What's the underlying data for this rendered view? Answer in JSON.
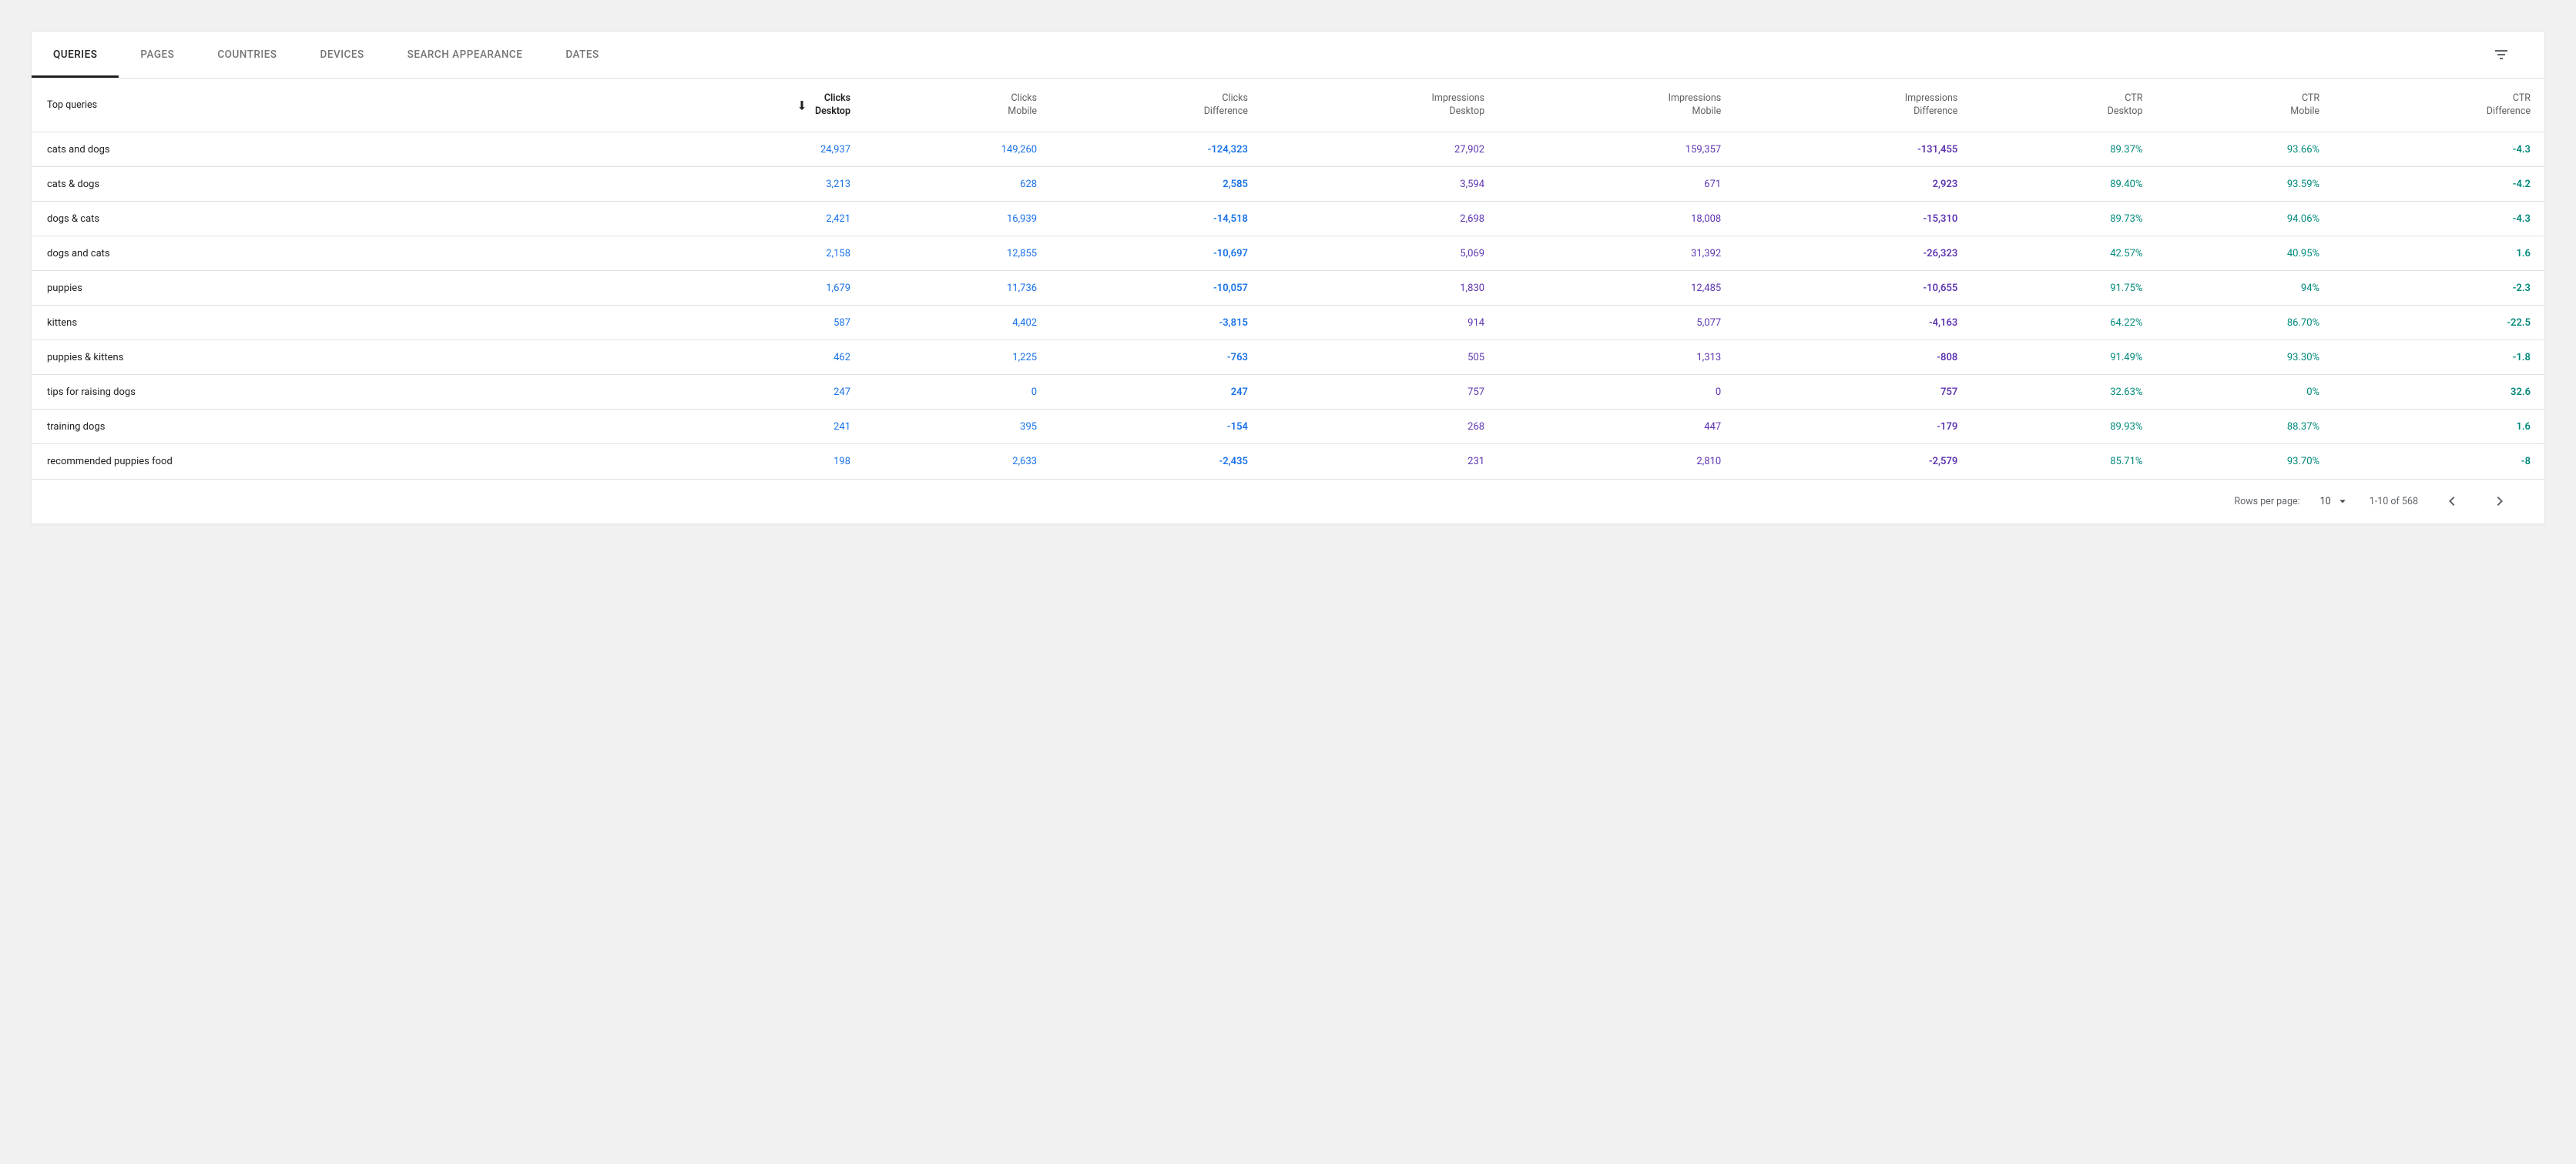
{
  "tabs": [
    {
      "label": "QUERIES",
      "active": true
    },
    {
      "label": "PAGES",
      "active": false
    },
    {
      "label": "COUNTRIES",
      "active": false
    },
    {
      "label": "DEVICES",
      "active": false
    },
    {
      "label": "SEARCH APPEARANCE",
      "active": false
    },
    {
      "label": "DATES",
      "active": false
    }
  ],
  "columns": [
    {
      "line1": "",
      "line2": "Top queries",
      "sortable": false,
      "align": "left"
    },
    {
      "line1": "Clicks",
      "line2": "Desktop",
      "sortable": true,
      "sorted": "desc"
    },
    {
      "line1": "Clicks",
      "line2": "Mobile",
      "sortable": false
    },
    {
      "line1": "Clicks",
      "line2": "Difference",
      "sortable": false
    },
    {
      "line1": "Impressions",
      "line2": "Desktop",
      "sortable": false
    },
    {
      "line1": "Impressions",
      "line2": "Mobile",
      "sortable": false
    },
    {
      "line1": "Impressions",
      "line2": "Difference",
      "sortable": false
    },
    {
      "line1": "CTR",
      "line2": "Desktop",
      "sortable": false
    },
    {
      "line1": "CTR",
      "line2": "Mobile",
      "sortable": false
    },
    {
      "line1": "CTR",
      "line2": "Difference",
      "sortable": false
    }
  ],
  "rows": [
    {
      "query": "cats and dogs",
      "clicks_d": "24,937",
      "clicks_m": "149,260",
      "clicks_diff": "-124,323",
      "impr_d": "27,902",
      "impr_m": "159,357",
      "impr_diff": "-131,455",
      "ctr_d": "89.37%",
      "ctr_m": "93.66%",
      "ctr_diff": "-4.3"
    },
    {
      "query": "cats & dogs",
      "clicks_d": "3,213",
      "clicks_m": "628",
      "clicks_diff": "2,585",
      "impr_d": "3,594",
      "impr_m": "671",
      "impr_diff": "2,923",
      "ctr_d": "89.40%",
      "ctr_m": "93.59%",
      "ctr_diff": "-4.2"
    },
    {
      "query": "dogs & cats",
      "clicks_d": "2,421",
      "clicks_m": "16,939",
      "clicks_diff": "-14,518",
      "impr_d": "2,698",
      "impr_m": "18,008",
      "impr_diff": "-15,310",
      "ctr_d": "89.73%",
      "ctr_m": "94.06%",
      "ctr_diff": "-4.3"
    },
    {
      "query": "dogs and cats",
      "clicks_d": "2,158",
      "clicks_m": "12,855",
      "clicks_diff": "-10,697",
      "impr_d": "5,069",
      "impr_m": "31,392",
      "impr_diff": "-26,323",
      "ctr_d": "42.57%",
      "ctr_m": "40.95%",
      "ctr_diff": "1.6"
    },
    {
      "query": "puppies",
      "clicks_d": "1,679",
      "clicks_m": "11,736",
      "clicks_diff": "-10,057",
      "impr_d": "1,830",
      "impr_m": "12,485",
      "impr_diff": "-10,655",
      "ctr_d": "91.75%",
      "ctr_m": "94%",
      "ctr_diff": "-2.3"
    },
    {
      "query": "kittens",
      "clicks_d": "587",
      "clicks_m": "4,402",
      "clicks_diff": "-3,815",
      "impr_d": "914",
      "impr_m": "5,077",
      "impr_diff": "-4,163",
      "ctr_d": "64.22%",
      "ctr_m": "86.70%",
      "ctr_diff": "-22.5"
    },
    {
      "query": "puppies & kittens",
      "clicks_d": "462",
      "clicks_m": "1,225",
      "clicks_diff": "-763",
      "impr_d": "505",
      "impr_m": "1,313",
      "impr_diff": "-808",
      "ctr_d": "91.49%",
      "ctr_m": "93.30%",
      "ctr_diff": "-1.8"
    },
    {
      "query": "tips for raising dogs",
      "clicks_d": "247",
      "clicks_m": "0",
      "clicks_diff": "247",
      "impr_d": "757",
      "impr_m": "0",
      "impr_diff": "757",
      "ctr_d": "32.63%",
      "ctr_m": "0%",
      "ctr_diff": "32.6"
    },
    {
      "query": "training dogs",
      "clicks_d": "241",
      "clicks_m": "395",
      "clicks_diff": "-154",
      "impr_d": "268",
      "impr_m": "447",
      "impr_diff": "-179",
      "ctr_d": "89.93%",
      "ctr_m": "88.37%",
      "ctr_diff": "1.6"
    },
    {
      "query": "recommended puppies food",
      "clicks_d": "198",
      "clicks_m": "2,633",
      "clicks_diff": "-2,435",
      "impr_d": "231",
      "impr_m": "2,810",
      "impr_diff": "-2,579",
      "ctr_d": "85.71%",
      "ctr_m": "93.70%",
      "ctr_diff": "-8"
    }
  ],
  "pagination": {
    "rows_per_page_label": "Rows per page:",
    "rows_per_page_value": "10",
    "range": "1-10 of 568"
  }
}
